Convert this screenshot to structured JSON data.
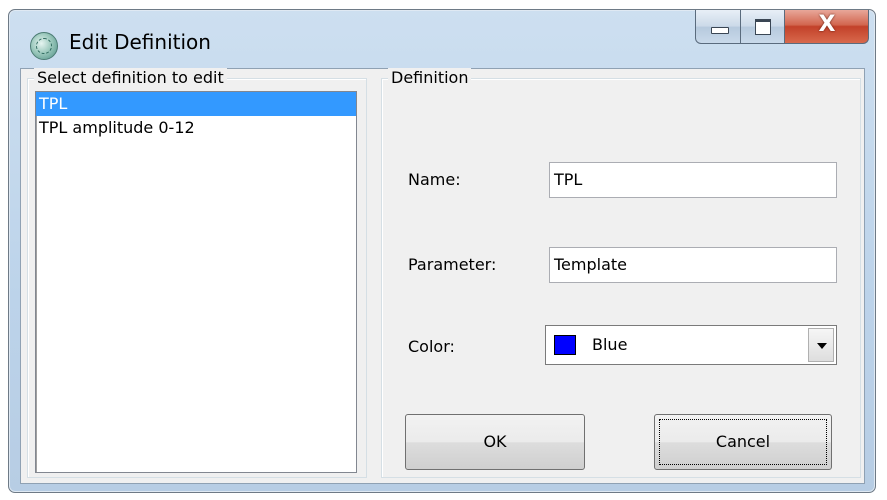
{
  "window": {
    "title": "Edit Definition",
    "icon": "globe-icon",
    "close_glyph": "X"
  },
  "left_group": {
    "legend": "Select definition to edit",
    "items": [
      {
        "label": "TPL",
        "selected": true
      },
      {
        "label": "TPL amplitude 0-12",
        "selected": false
      }
    ]
  },
  "definition": {
    "legend": "Definition",
    "name_label": "Name:",
    "name_value": "TPL",
    "parameter_label": "Parameter:",
    "parameter_value": "Template",
    "color_label": "Color:",
    "color_value": "Blue",
    "color_hex": "#0000ff"
  },
  "buttons": {
    "ok_label": "OK",
    "cancel_label": "Cancel"
  }
}
